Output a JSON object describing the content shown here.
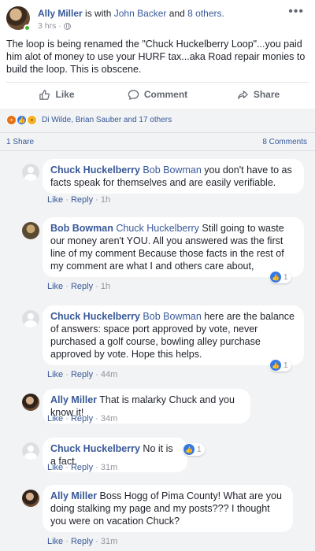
{
  "post": {
    "author": "Ally Miller",
    "with_text": "is with",
    "tagged": "John Backer",
    "and_text": "and",
    "others": "8 others.",
    "time": "3 hrs",
    "more_icon": "more-horizontal-icon",
    "body": "The loop is being renamed the \"Chuck Huckelberry Loop\"...you paid him alot of money to use your HURF tax...aka Road repair monies to build the loop. This is obscene."
  },
  "actions": {
    "like": "Like",
    "comment": "Comment",
    "share": "Share"
  },
  "reactions": {
    "summary": "Di Wilde, Brian Sauber and 17 others",
    "icons": [
      "angry",
      "like",
      "haha"
    ]
  },
  "counts": {
    "shares": "1 Share",
    "comments": "8 Comments"
  },
  "comments": [
    {
      "author": "Chuck Huckelberry",
      "mention": "Bob Bowman",
      "text": "you don't have to as facts speak for themselves and are easily verifiable.",
      "like": "Like",
      "reply": "Reply",
      "time": "1h",
      "reactions": ""
    },
    {
      "author": "Bob Bowman",
      "mention": "Chuck Huckelberry",
      "text": "Still going to waste our money aren't YOU. All you answered was the first line of my comment Because those facts in the rest of my comment are what I and others care about,",
      "like": "Like",
      "reply": "Reply",
      "time": "1h",
      "reactions": "1"
    },
    {
      "author": "Chuck Huckelberry",
      "mention": "Bob Bowman",
      "text": "here are the balance of answers: space port approved by vote, never purchased a golf course, bowling alley purchase approved by vote. Hope this helps.",
      "like": "Like",
      "reply": "Reply",
      "time": "44m",
      "reactions": "1"
    },
    {
      "author": "Ally Miller",
      "mention": "",
      "text": "That is malarky Chuck and you know it!",
      "like": "Like",
      "reply": "Reply",
      "time": "34m",
      "reactions": ""
    },
    {
      "author": "Chuck Huckelberry",
      "mention": "",
      "text": "No it is a fact.",
      "like": "Like",
      "reply": "Reply",
      "time": "31m",
      "reactions": "1"
    },
    {
      "author": "Ally Miller",
      "mention": "",
      "text": "Boss Hogg of Pima County! What are you doing stalking my page and my posts??? I thought you were on vacation Chuck?",
      "like": "Like",
      "reply": "Reply",
      "time": "31m",
      "reactions": ""
    }
  ],
  "colors": {
    "link": "#365899",
    "like_blue": "#3578e5",
    "background": "#f2f3f5"
  }
}
